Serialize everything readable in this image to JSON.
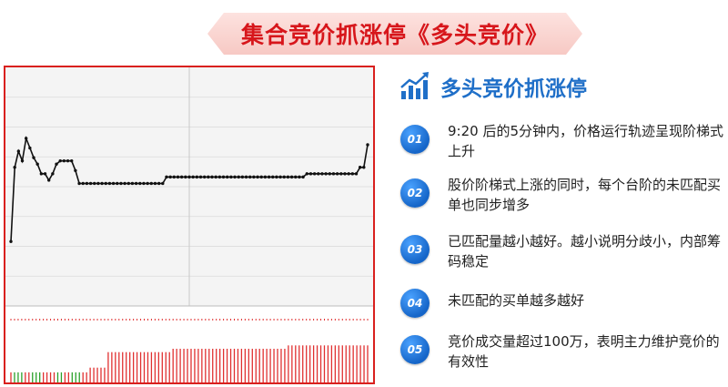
{
  "title": "集合竞价抓涨停《多头竞价》",
  "panel": {
    "heading": "多头竞价抓涨停",
    "items": [
      {
        "num": "01",
        "text": "9:20 后的5分钟内，价格运行轨迹呈现阶梯式上升"
      },
      {
        "num": "02",
        "text": "股价阶梯式上涨的同时，每个台阶的未匹配买单也同步增多"
      },
      {
        "num": "03",
        "text": "已匹配量越小越好。越小说明分歧小，内部筹码稳定"
      },
      {
        "num": "04",
        "text": "未匹配的买单越多越好"
      },
      {
        "num": "05",
        "text": "竞价成交量超过100万，表明主力维护竞价的有效性"
      }
    ]
  },
  "colors": {
    "accent_red": "#d7161b",
    "accent_blue": "#1f6fc8",
    "number_bubble": "#1565c8",
    "volume_up": "#e03030",
    "volume_down": "#2aa02a"
  },
  "icons": {
    "heading": "bar-chart-trend-icon"
  },
  "chart_data": {
    "type": "line",
    "price_series": {
      "y_relative_to_open": [
        -1.8,
        0.5,
        1.0,
        0.7,
        1.4,
        1.1,
        0.8,
        0.6,
        0.3,
        0.3,
        0.1,
        0.3,
        0.6,
        0.7,
        0.7,
        0.7,
        0.7,
        0.4,
        0.0,
        0.0,
        0.0,
        0.0,
        0.0,
        0.0,
        0.0,
        0.0,
        0.0,
        0.0,
        0.0,
        0.0,
        0.0,
        0.0,
        0.0,
        0.0,
        0.0,
        0.0,
        0.0,
        0.0,
        0.0,
        0.0,
        0.0,
        0.2,
        0.2,
        0.2,
        0.2,
        0.2,
        0.2,
        0.2,
        0.2,
        0.2,
        0.2,
        0.2,
        0.2,
        0.2,
        0.2,
        0.2,
        0.2,
        0.2,
        0.2,
        0.2,
        0.2,
        0.2,
        0.2,
        0.2,
        0.2,
        0.2,
        0.2,
        0.2,
        0.2,
        0.2,
        0.2,
        0.2,
        0.2,
        0.2,
        0.2,
        0.2,
        0.2,
        0.2,
        0.3,
        0.3,
        0.3,
        0.3,
        0.3,
        0.3,
        0.3,
        0.3,
        0.3,
        0.3,
        0.3,
        0.3,
        0.3,
        0.3,
        0.5,
        0.5,
        1.2
      ],
      "ylim": [
        -3.8,
        3.6
      ]
    },
    "volume_series": {
      "up_levels": [
        0.15,
        0.15,
        0.15,
        0.15,
        0.15,
        0.15,
        0.15,
        0.15,
        0.15,
        0.15,
        0.15,
        0.15,
        0.15,
        0.15,
        0.15,
        0.15,
        0.15,
        0.15,
        0.15,
        0.15,
        0.15,
        0.15,
        0.22,
        0.22,
        0.22,
        0.22,
        0.22,
        0.45,
        0.45,
        0.45,
        0.45,
        0.45,
        0.45,
        0.45,
        0.45,
        0.45,
        0.45,
        0.45,
        0.45,
        0.45,
        0.45,
        0.45,
        0.45,
        0.45,
        0.45,
        0.5,
        0.5,
        0.5,
        0.5,
        0.5,
        0.5,
        0.5,
        0.5,
        0.5,
        0.5,
        0.5,
        0.5,
        0.5,
        0.5,
        0.5,
        0.5,
        0.5,
        0.5,
        0.5,
        0.5,
        0.5,
        0.5,
        0.5,
        0.5,
        0.5,
        0.5,
        0.5,
        0.5,
        0.5,
        0.5,
        0.5,
        0.5,
        0.55,
        0.55,
        0.55,
        0.55,
        0.55,
        0.55,
        0.55,
        0.55,
        0.55,
        0.55,
        0.55,
        0.55,
        0.55,
        0.55,
        0.55,
        0.55,
        0.55,
        0.55,
        0.55,
        0.55,
        0.55,
        0.55,
        0.55
      ],
      "green_indices": [
        1,
        2,
        3,
        6,
        7,
        8,
        13,
        14,
        17,
        18,
        19
      ]
    }
  }
}
